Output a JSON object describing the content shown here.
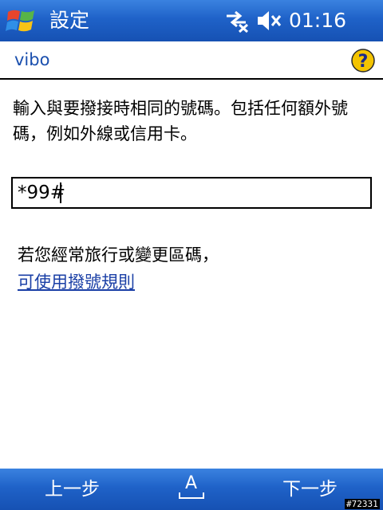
{
  "titlebar": {
    "title": "設定",
    "clock": "01:16",
    "icons": [
      "windows-start-icon",
      "connectivity-icon",
      "volume-muted-icon"
    ]
  },
  "header": {
    "title": "vibo",
    "help_icon": "help-icon"
  },
  "content": {
    "instruction": "輸入與要撥接時相同的號碼。包括任何額外號碼，例如外線或信用卡。",
    "dial_number_value": "*99#",
    "travel_note": "若您經常旅行或變更區碼，",
    "rules_link": "可使用撥號規則"
  },
  "softkeys": {
    "left": "上一步",
    "sip_glyph": "A",
    "right": "下一步"
  },
  "watermark": "#72331",
  "colors": {
    "bar_top": "#3a82e0",
    "bar_bottom": "#1651b3",
    "header_text": "#1a4fae",
    "link": "#1a3fa6",
    "help_yellow": "#f4c400"
  }
}
